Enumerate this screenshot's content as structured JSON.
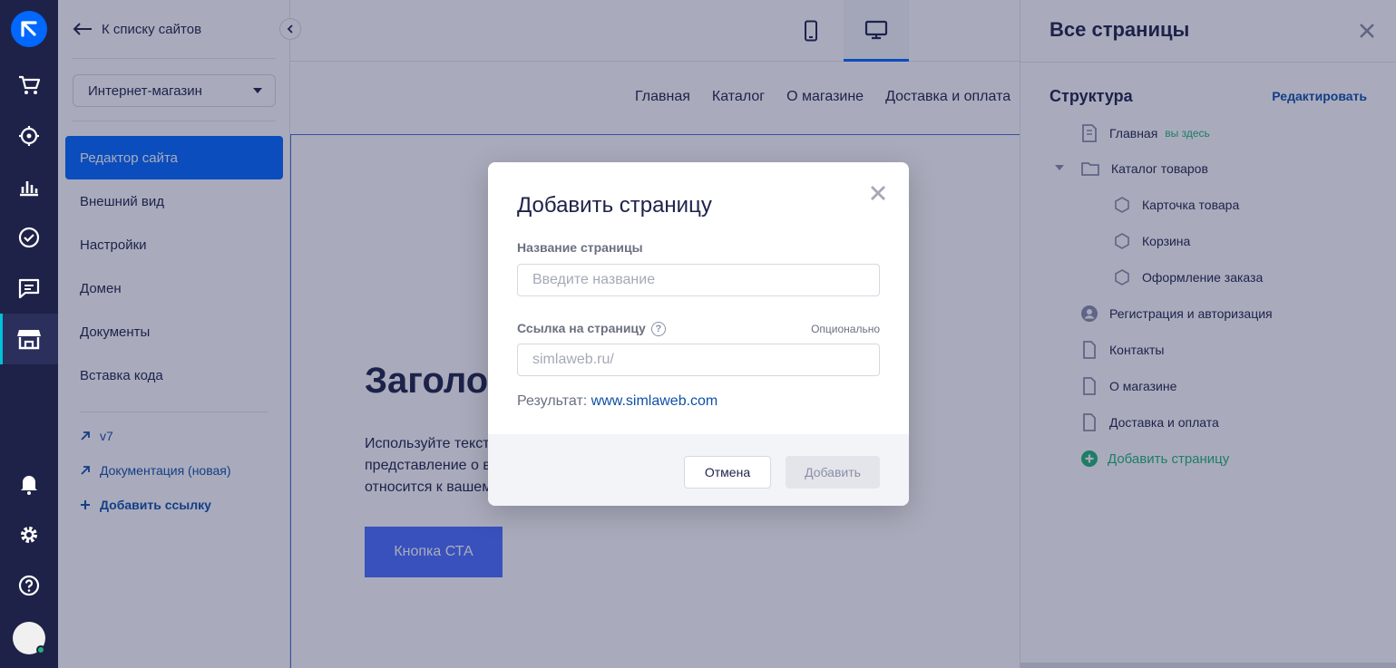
{
  "sidebar": {
    "back_label": "К списку сайтов",
    "site_select": "Интернет-магазин",
    "menu": [
      {
        "label": "Редактор сайта",
        "active": true
      },
      {
        "label": "Внешний вид"
      },
      {
        "label": "Настройки"
      },
      {
        "label": "Домен"
      },
      {
        "label": "Документы"
      },
      {
        "label": "Вставка кода"
      }
    ],
    "links": [
      {
        "label": "v7",
        "icon": "arrow-up-right-icon"
      },
      {
        "label": "Документация (новая)",
        "icon": "arrow-up-right-icon"
      },
      {
        "label": "Добавить ссылку",
        "icon": "plus-icon"
      }
    ]
  },
  "canvas": {
    "devices": [
      "mobile-icon",
      "desktop-icon"
    ],
    "nav": [
      "Главная",
      "Каталог",
      "О магазине",
      "Доставка и оплата"
    ],
    "hero_title": "Заголо",
    "hero_text": [
      "Используйте текст",
      "представление о в",
      "относится к вашем"
    ],
    "cta_label": "Кнопка СТА"
  },
  "panel": {
    "title": "Все страницы",
    "structure_label": "Структура",
    "edit_label": "Редактировать",
    "pages": [
      {
        "label": "Главная",
        "badge": "вы здесь",
        "icon": "page-home-icon"
      },
      {
        "label": "Каталог товаров",
        "icon": "folder-icon"
      },
      {
        "label": "Карточка товара",
        "icon": "hexagon-icon"
      },
      {
        "label": "Корзина",
        "icon": "hexagon-icon"
      },
      {
        "label": "Оформление заказа",
        "icon": "hexagon-icon"
      },
      {
        "label": "Регистрация и авторизация",
        "icon": "user-circle-icon"
      },
      {
        "label": "Контакты",
        "icon": "page-icon"
      },
      {
        "label": "О магазине",
        "icon": "page-icon"
      },
      {
        "label": "Доставка и оплата",
        "icon": "page-icon"
      }
    ],
    "add_page_label": "Добавить страницу"
  },
  "modal": {
    "title": "Добавить страницу",
    "name_label": "Название страницы",
    "name_placeholder": "Введите название",
    "link_label": "Ссылка на страницу",
    "optional_label": "Опционально",
    "link_placeholder": "simlaweb.ru/",
    "result_label": "Результат:",
    "result_url": "www.simlaweb.com",
    "cancel_label": "Отмена",
    "add_label": "Добавить"
  },
  "colors": {
    "rail": "#1e2248",
    "accent": "#0068ff",
    "link": "#0f4fa8",
    "success": "#21b573"
  }
}
